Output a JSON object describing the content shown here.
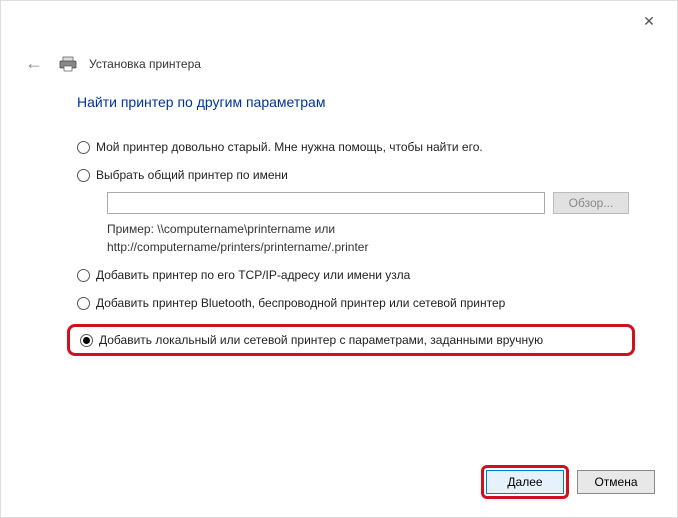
{
  "window": {
    "close_label": "✕"
  },
  "header": {
    "back_arrow": "←",
    "title": "Установка принтера"
  },
  "page": {
    "heading": "Найти принтер по другим параметрам"
  },
  "options": {
    "old_printer": "Мой принтер довольно старый. Мне нужна помощь, чтобы найти его.",
    "shared_by_name": "Выбрать общий принтер по имени",
    "browse_label": "Обзор...",
    "example_line1": "Пример: \\\\computername\\printername или",
    "example_line2": "http://computername/printers/printername/.printer",
    "tcpip": "Добавить принтер по его TCP/IP-адресу или имени узла",
    "bluetooth": "Добавить принтер Bluetooth, беспроводной принтер или сетевой принтер",
    "local_manual": "Добавить локальный или сетевой принтер с параметрами, заданными вручную"
  },
  "input": {
    "shared_name_value": ""
  },
  "footer": {
    "next": "Далее",
    "cancel": "Отмена"
  }
}
